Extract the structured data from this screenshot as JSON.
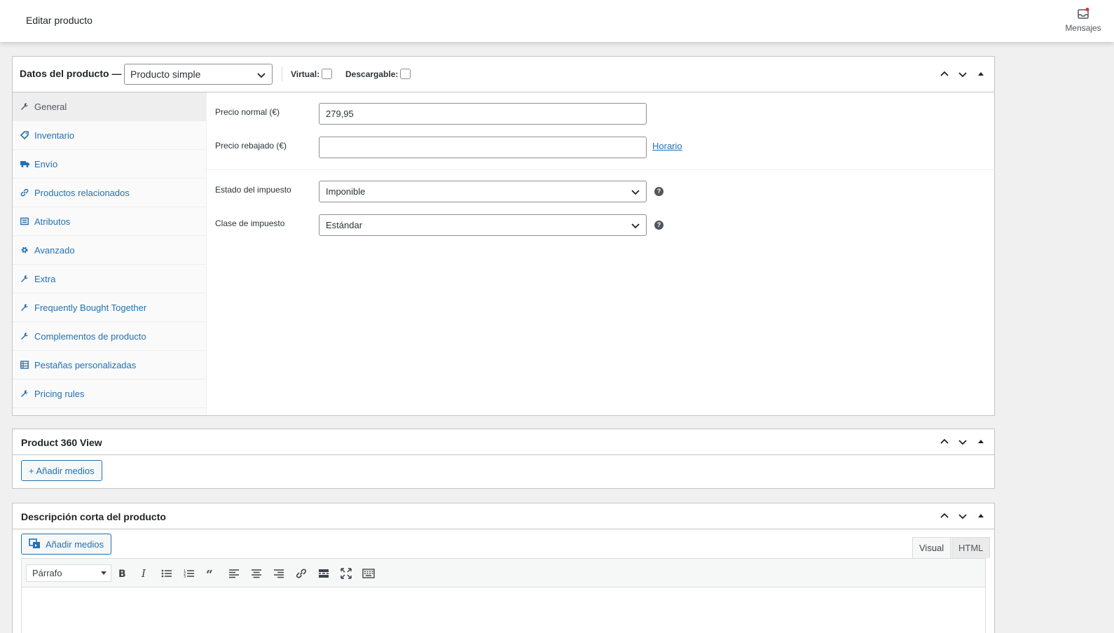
{
  "header": {
    "title": "Editar producto",
    "messages_label": "Mensajes"
  },
  "product_data": {
    "label": "Datos del producto —",
    "type_selected": "Producto simple",
    "virtual_label": "Virtual:",
    "downloadable_label": "Descargable:",
    "tabs": [
      {
        "label": "General",
        "icon": "wrench-icon"
      },
      {
        "label": "Inventario",
        "icon": "tag-icon"
      },
      {
        "label": "Envío",
        "icon": "truck-icon"
      },
      {
        "label": "Productos relacionados",
        "icon": "link-icon"
      },
      {
        "label": "Atributos",
        "icon": "list-icon"
      },
      {
        "label": "Avanzado",
        "icon": "gear-icon"
      },
      {
        "label": "Extra",
        "icon": "wrench-icon"
      },
      {
        "label": "Frequently Bought Together",
        "icon": "wrench-icon"
      },
      {
        "label": "Complementos de producto",
        "icon": "wrench-icon"
      },
      {
        "label": "Pestañas personalizadas",
        "icon": "table-icon"
      },
      {
        "label": "Pricing rules",
        "icon": "wrench-icon"
      }
    ],
    "fields": {
      "regular_price_label": "Precio normal (€)",
      "regular_price_value": "279,95",
      "sale_price_label": "Precio rebajado (€)",
      "sale_price_value": "",
      "schedule_link": "Horario",
      "tax_status_label": "Estado del impuesto",
      "tax_status_value": "Imponible",
      "tax_class_label": "Clase de impuesto",
      "tax_class_value": "Estándar"
    }
  },
  "view360": {
    "title": "Product 360 View",
    "add_media": "+ Añadir medios"
  },
  "short_desc": {
    "title": "Descripción corta del producto",
    "add_media": "Añadir medios",
    "tab_visual": "Visual",
    "tab_html": "HTML",
    "format_selected": "Párrafo"
  }
}
